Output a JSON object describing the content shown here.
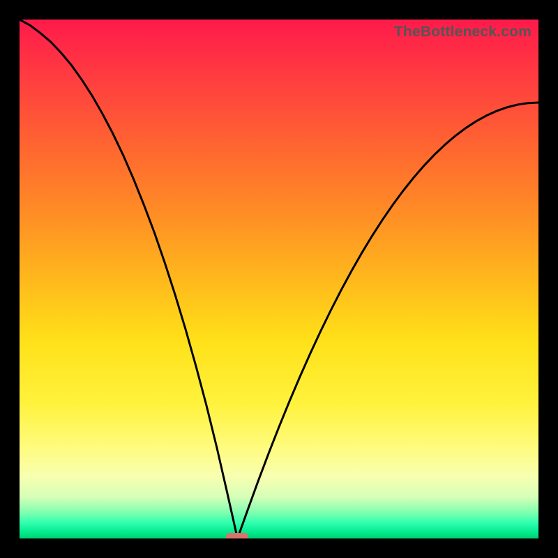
{
  "watermark": "TheBottleneck.com",
  "colors": {
    "frame": "#000000",
    "curve": "#000000",
    "marker": "#d9736b"
  },
  "chart_data": {
    "type": "line",
    "title": "",
    "xlabel": "",
    "ylabel": "",
    "xlim": [
      0,
      100
    ],
    "ylim": [
      0,
      100
    ],
    "minimum_x": 42,
    "marker": {
      "x": 42,
      "y": 0
    },
    "x": [
      0,
      2,
      4,
      6,
      8,
      10,
      12,
      14,
      16,
      18,
      20,
      22,
      24,
      26,
      28,
      30,
      32,
      34,
      36,
      38,
      40,
      42,
      44,
      46,
      48,
      50,
      52,
      54,
      56,
      58,
      60,
      62,
      64,
      66,
      68,
      70,
      72,
      74,
      76,
      78,
      80,
      82,
      84,
      86,
      88,
      90,
      92,
      94,
      96,
      98,
      100
    ],
    "y": [
      100,
      98.9,
      97.4,
      95.7,
      93.6,
      91.2,
      88.4,
      85.3,
      81.8,
      78.0,
      73.8,
      69.2,
      64.2,
      58.9,
      53.1,
      46.9,
      40.3,
      33.2,
      25.7,
      17.6,
      8.9,
      0,
      5.6,
      11.1,
      16.4,
      21.5,
      26.4,
      31.1,
      35.6,
      39.9,
      44.0,
      47.9,
      51.6,
      55.1,
      58.4,
      61.5,
      64.4,
      67.1,
      69.6,
      71.9,
      74.0,
      75.9,
      77.6,
      79.1,
      80.4,
      81.5,
      82.4,
      83.1,
      83.6,
      83.9,
      84.0
    ]
  }
}
